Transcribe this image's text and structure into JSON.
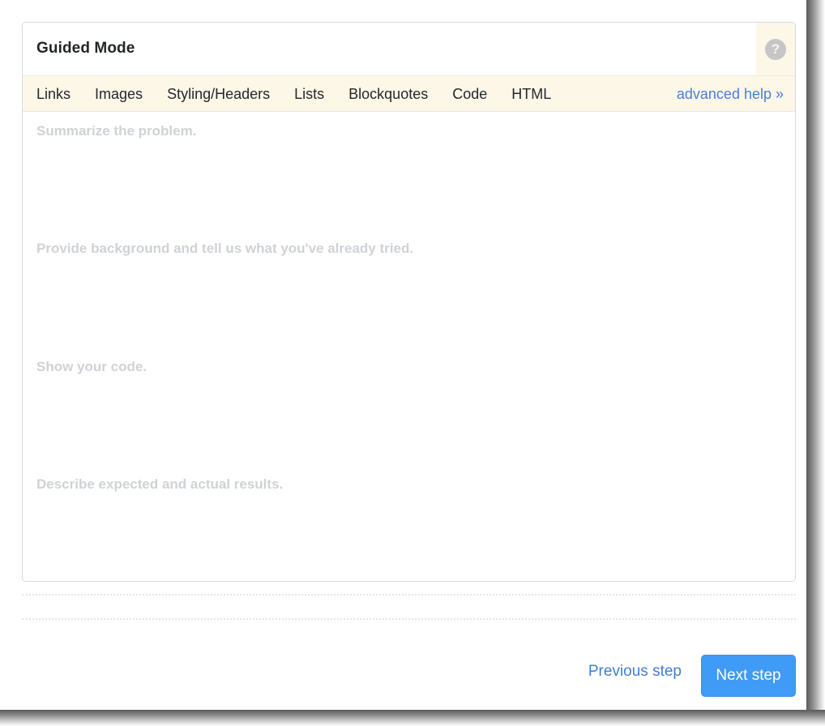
{
  "editor": {
    "title": "Guided Mode",
    "help_icon_glyph": "?",
    "help_icon_name": "question-mark-help-icon",
    "toolbar": {
      "items": [
        {
          "label": "Links"
        },
        {
          "label": "Images"
        },
        {
          "label": "Styling/Headers"
        },
        {
          "label": "Lists"
        },
        {
          "label": "Blockquotes"
        },
        {
          "label": "Code"
        },
        {
          "label": "HTML"
        }
      ],
      "advanced_help_label": "advanced help »"
    },
    "placeholders": [
      "Summarize the problem.",
      "Provide background and tell us what you've already tried.",
      "Show your code.",
      "Describe expected and actual results."
    ],
    "field_values": [
      "",
      "",
      "",
      ""
    ]
  },
  "footer": {
    "previous_step_label": "Previous step",
    "next_step_label": "Next step"
  },
  "colors": {
    "toolbar_background": "#fdf7e8",
    "link_blue": "#4a7fd4",
    "button_blue": "#3f9bf5",
    "placeholder_gray": "#cfd2d6",
    "border_gray": "#d6d9dc"
  }
}
